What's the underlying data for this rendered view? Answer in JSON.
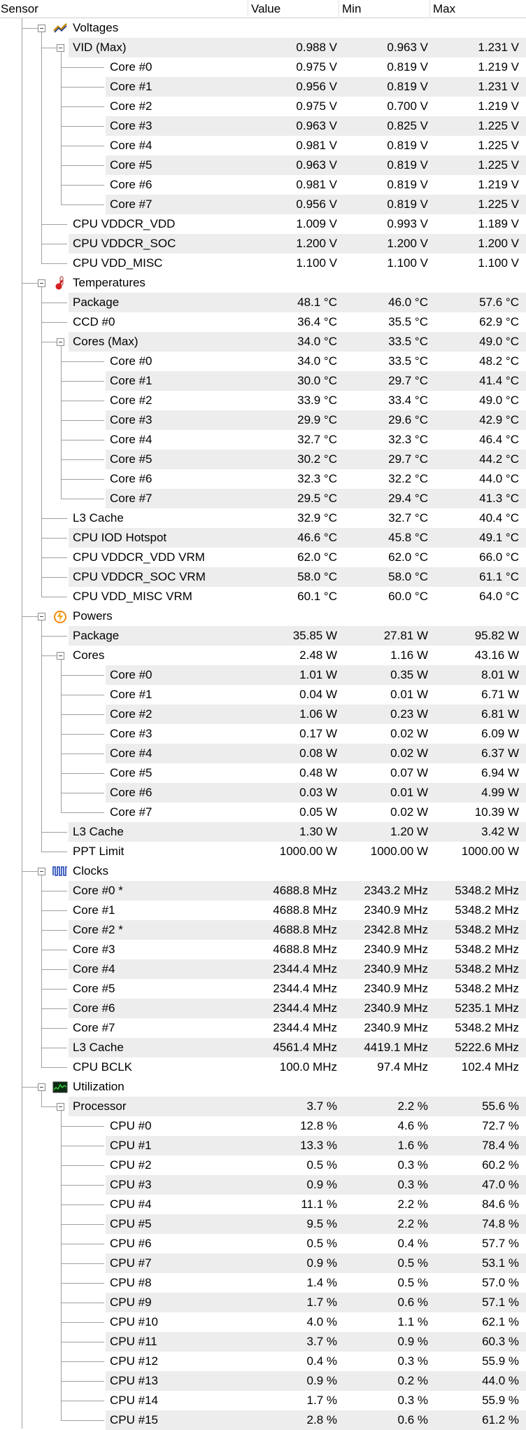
{
  "header": {
    "sensor": "Sensor",
    "value": "Value",
    "min": "Min",
    "max": "Max"
  },
  "groups": [
    {
      "name": "voltages",
      "label": "Voltages",
      "icon": "voltage-icon",
      "rows": [
        {
          "level": 2,
          "label": "VID (Max)",
          "value": "0.988 V",
          "min": "0.963 V",
          "max": "1.231 V",
          "children": [
            {
              "label": "Core #0",
              "value": "0.975 V",
              "min": "0.819 V",
              "max": "1.219 V"
            },
            {
              "label": "Core #1",
              "value": "0.956 V",
              "min": "0.819 V",
              "max": "1.231 V"
            },
            {
              "label": "Core #2",
              "value": "0.975 V",
              "min": "0.700 V",
              "max": "1.219 V"
            },
            {
              "label": "Core #3",
              "value": "0.963 V",
              "min": "0.825 V",
              "max": "1.225 V"
            },
            {
              "label": "Core #4",
              "value": "0.981 V",
              "min": "0.819 V",
              "max": "1.225 V"
            },
            {
              "label": "Core #5",
              "value": "0.963 V",
              "min": "0.819 V",
              "max": "1.225 V"
            },
            {
              "label": "Core #6",
              "value": "0.981 V",
              "min": "0.819 V",
              "max": "1.219 V"
            },
            {
              "label": "Core #7",
              "value": "0.956 V",
              "min": "0.819 V",
              "max": "1.225 V"
            }
          ]
        },
        {
          "label": "CPU VDDCR_VDD",
          "value": "1.009 V",
          "min": "0.993 V",
          "max": "1.189 V"
        },
        {
          "label": "CPU VDDCR_SOC",
          "value": "1.200 V",
          "min": "1.200 V",
          "max": "1.200 V"
        },
        {
          "label": "CPU VDD_MISC",
          "value": "1.100 V",
          "min": "1.100 V",
          "max": "1.100 V"
        }
      ]
    },
    {
      "name": "temperatures",
      "label": "Temperatures",
      "icon": "thermometer-icon",
      "rows": [
        {
          "label": "Package",
          "value": "48.1 °C",
          "min": "46.0 °C",
          "max": "57.6 °C"
        },
        {
          "label": "CCD #0",
          "value": "36.4 °C",
          "min": "35.5 °C",
          "max": "62.9 °C"
        },
        {
          "label": "Cores (Max)",
          "value": "34.0 °C",
          "min": "33.5 °C",
          "max": "49.0 °C",
          "children": [
            {
              "label": "Core #0",
              "value": "34.0 °C",
              "min": "33.5 °C",
              "max": "48.2 °C"
            },
            {
              "label": "Core #1",
              "value": "30.0 °C",
              "min": "29.7 °C",
              "max": "41.4 °C"
            },
            {
              "label": "Core #2",
              "value": "33.9 °C",
              "min": "33.4 °C",
              "max": "49.0 °C"
            },
            {
              "label": "Core #3",
              "value": "29.9 °C",
              "min": "29.6 °C",
              "max": "42.9 °C"
            },
            {
              "label": "Core #4",
              "value": "32.7 °C",
              "min": "32.3 °C",
              "max": "46.4 °C"
            },
            {
              "label": "Core #5",
              "value": "30.2 °C",
              "min": "29.7 °C",
              "max": "44.2 °C"
            },
            {
              "label": "Core #6",
              "value": "32.3 °C",
              "min": "32.2 °C",
              "max": "44.0 °C"
            },
            {
              "label": "Core #7",
              "value": "29.5 °C",
              "min": "29.4 °C",
              "max": "41.3 °C"
            }
          ]
        },
        {
          "label": "L3 Cache",
          "value": "32.9 °C",
          "min": "32.7 °C",
          "max": "40.4 °C"
        },
        {
          "label": "CPU IOD Hotspot",
          "value": "46.6 °C",
          "min": "45.8 °C",
          "max": "49.1 °C"
        },
        {
          "label": "CPU VDDCR_VDD VRM",
          "value": "62.0 °C",
          "min": "62.0 °C",
          "max": "66.0 °C"
        },
        {
          "label": "CPU VDDCR_SOC VRM",
          "value": "58.0 °C",
          "min": "58.0 °C",
          "max": "61.1 °C"
        },
        {
          "label": "CPU VDD_MISC VRM",
          "value": "60.1 °C",
          "min": "60.0 °C",
          "max": "64.0 °C"
        }
      ]
    },
    {
      "name": "powers",
      "label": "Powers",
      "icon": "power-icon",
      "rows": [
        {
          "label": "Package",
          "value": "35.85 W",
          "min": "27.81 W",
          "max": "95.82 W"
        },
        {
          "label": "Cores",
          "value": "2.48 W",
          "min": "1.16 W",
          "max": "43.16 W",
          "children": [
            {
              "label": "Core #0",
              "value": "1.01 W",
              "min": "0.35 W",
              "max": "8.01 W"
            },
            {
              "label": "Core #1",
              "value": "0.04 W",
              "min": "0.01 W",
              "max": "6.71 W"
            },
            {
              "label": "Core #2",
              "value": "1.06 W",
              "min": "0.23 W",
              "max": "6.81 W"
            },
            {
              "label": "Core #3",
              "value": "0.17 W",
              "min": "0.02 W",
              "max": "6.09 W"
            },
            {
              "label": "Core #4",
              "value": "0.08 W",
              "min": "0.02 W",
              "max": "6.37 W"
            },
            {
              "label": "Core #5",
              "value": "0.48 W",
              "min": "0.07 W",
              "max": "6.94 W"
            },
            {
              "label": "Core #6",
              "value": "0.03 W",
              "min": "0.01 W",
              "max": "4.99 W"
            },
            {
              "label": "Core #7",
              "value": "0.05 W",
              "min": "0.02 W",
              "max": "10.39 W"
            }
          ]
        },
        {
          "label": "L3 Cache",
          "value": "1.30 W",
          "min": "1.20 W",
          "max": "3.42 W"
        },
        {
          "label": "PPT Limit",
          "value": "1000.00 W",
          "min": "1000.00 W",
          "max": "1000.00 W"
        }
      ]
    },
    {
      "name": "clocks",
      "label": "Clocks",
      "icon": "clock-signal-icon",
      "rows": [
        {
          "label": "Core #0 *",
          "value": "4688.8 MHz",
          "min": "2343.2 MHz",
          "max": "5348.2 MHz"
        },
        {
          "label": "Core #1",
          "value": "4688.8 MHz",
          "min": "2340.9 MHz",
          "max": "5348.2 MHz"
        },
        {
          "label": "Core #2 *",
          "value": "4688.8 MHz",
          "min": "2342.8 MHz",
          "max": "5348.2 MHz"
        },
        {
          "label": "Core #3",
          "value": "4688.8 MHz",
          "min": "2340.9 MHz",
          "max": "5348.2 MHz"
        },
        {
          "label": "Core #4",
          "value": "2344.4 MHz",
          "min": "2340.9 MHz",
          "max": "5348.2 MHz"
        },
        {
          "label": "Core #5",
          "value": "2344.4 MHz",
          "min": "2340.9 MHz",
          "max": "5348.2 MHz"
        },
        {
          "label": "Core #6",
          "value": "2344.4 MHz",
          "min": "2340.9 MHz",
          "max": "5235.1 MHz"
        },
        {
          "label": "Core #7",
          "value": "2344.4 MHz",
          "min": "2340.9 MHz",
          "max": "5348.2 MHz"
        },
        {
          "label": "L3 Cache",
          "value": "4561.4 MHz",
          "min": "4419.1 MHz",
          "max": "5222.6 MHz"
        },
        {
          "label": "CPU BCLK",
          "value": "100.0 MHz",
          "min": "97.4 MHz",
          "max": "102.4 MHz"
        }
      ]
    },
    {
      "name": "utilization",
      "label": "Utilization",
      "icon": "utilization-graph-icon",
      "rows": [
        {
          "label": "Processor",
          "value": "3.7 %",
          "min": "2.2 %",
          "max": "55.6 %",
          "children": [
            {
              "label": "CPU #0",
              "value": "12.8 %",
              "min": "4.6 %",
              "max": "72.7 %"
            },
            {
              "label": "CPU #1",
              "value": "13.3 %",
              "min": "1.6 %",
              "max": "78.4 %"
            },
            {
              "label": "CPU #2",
              "value": "0.5 %",
              "min": "0.3 %",
              "max": "60.2 %"
            },
            {
              "label": "CPU #3",
              "value": "0.9 %",
              "min": "0.3 %",
              "max": "47.0 %"
            },
            {
              "label": "CPU #4",
              "value": "11.1 %",
              "min": "2.2 %",
              "max": "84.6 %"
            },
            {
              "label": "CPU #5",
              "value": "9.5 %",
              "min": "2.2 %",
              "max": "74.8 %"
            },
            {
              "label": "CPU #6",
              "value": "0.5 %",
              "min": "0.4 %",
              "max": "57.7 %"
            },
            {
              "label": "CPU #7",
              "value": "0.9 %",
              "min": "0.5 %",
              "max": "53.1 %"
            },
            {
              "label": "CPU #8",
              "value": "1.4 %",
              "min": "0.5 %",
              "max": "57.0 %"
            },
            {
              "label": "CPU #9",
              "value": "1.7 %",
              "min": "0.6 %",
              "max": "57.1 %"
            },
            {
              "label": "CPU #10",
              "value": "4.0 %",
              "min": "1.1 %",
              "max": "62.1 %"
            },
            {
              "label": "CPU #11",
              "value": "3.7 %",
              "min": "0.9 %",
              "max": "60.3 %"
            },
            {
              "label": "CPU #12",
              "value": "0.4 %",
              "min": "0.3 %",
              "max": "55.9 %"
            },
            {
              "label": "CPU #13",
              "value": "0.9 %",
              "min": "0.2 %",
              "max": "44.0 %"
            },
            {
              "label": "CPU #14",
              "value": "1.7 %",
              "min": "0.3 %",
              "max": "55.9 %"
            },
            {
              "label": "CPU #15",
              "value": "2.8 %",
              "min": "0.6 %",
              "max": "61.2 %"
            }
          ]
        }
      ]
    }
  ]
}
